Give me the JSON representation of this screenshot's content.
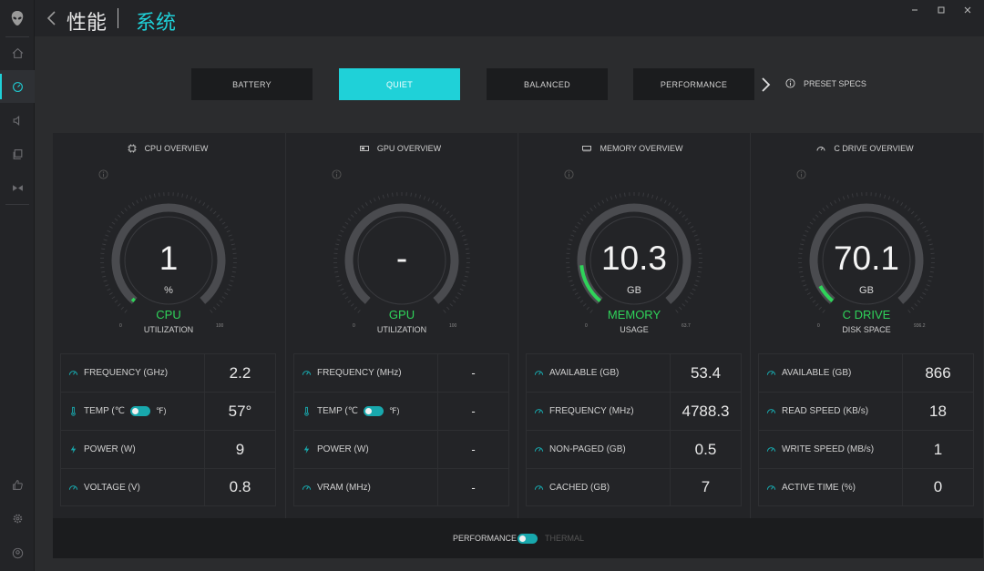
{
  "header": {
    "title": "性能",
    "subtitle": "系统"
  },
  "modes": [
    {
      "label": "BATTERY",
      "selected": false
    },
    {
      "label": "QUIET",
      "selected": true
    },
    {
      "label": "BALANCED",
      "selected": false
    },
    {
      "label": "PERFORMANCE",
      "selected": false
    }
  ],
  "preset_specs": "PRESET SPECS",
  "colors": {
    "accent": "#1fd1d8",
    "gauge_fill": "#2fd35a"
  },
  "panels": [
    {
      "title": "CPU OVERVIEW",
      "gauge": {
        "value": "1",
        "unit": "%",
        "name": "CPU",
        "subtitle": "UTILIZATION",
        "min": "0",
        "max": "100",
        "fill": 0.01
      },
      "rows": [
        {
          "label": "FREQUENCY (GHz)",
          "value": "2.2"
        },
        {
          "label": "TEMP (℃",
          "suffix": "℉)",
          "value": "57°"
        },
        {
          "label": "POWER (W)",
          "value": "9"
        },
        {
          "label": "VOLTAGE (V)",
          "value": "0.8"
        }
      ]
    },
    {
      "title": "GPU OVERVIEW",
      "gauge": {
        "value": "-",
        "unit": "",
        "name": "GPU",
        "subtitle": "UTILIZATION",
        "min": "0",
        "max": "100",
        "fill": 0
      },
      "rows": [
        {
          "label": "FREQUENCY (MHz)",
          "value": "-"
        },
        {
          "label": "TEMP (℃",
          "suffix": "℉)",
          "value": "-"
        },
        {
          "label": "POWER (W)",
          "value": "-"
        },
        {
          "label": "VRAM (MHz)",
          "value": "-"
        }
      ]
    },
    {
      "title": "MEMORY OVERVIEW",
      "gauge": {
        "value": "10.3",
        "unit": "GB",
        "name": "MEMORY",
        "subtitle": "USAGE",
        "min": "0",
        "max": "63.7",
        "fill": 0.16
      },
      "rows": [
        {
          "label": "AVAILABLE (GB)",
          "value": "53.4"
        },
        {
          "label": "FREQUENCY (MHz)",
          "value": "4788.3"
        },
        {
          "label": "NON-PAGED (GB)",
          "value": "0.5"
        },
        {
          "label": "CACHED (GB)",
          "value": "7"
        }
      ]
    },
    {
      "title": "C DRIVE OVERVIEW",
      "gauge": {
        "value": "70.1",
        "unit": "GB",
        "name": "C DRIVE",
        "subtitle": "DISK SPACE",
        "min": "0",
        "max": "936.2",
        "fill": 0.075
      },
      "rows": [
        {
          "label": "AVAILABLE (GB)",
          "value": "866"
        },
        {
          "label": "READ SPEED (KB/s)",
          "value": "18"
        },
        {
          "label": "WRITE SPEED (MB/s)",
          "value": "1"
        },
        {
          "label": "ACTIVE TIME (%)",
          "value": "0"
        }
      ]
    }
  ],
  "footer": {
    "left": "PERFORMANCE",
    "right": "THERMAL"
  }
}
